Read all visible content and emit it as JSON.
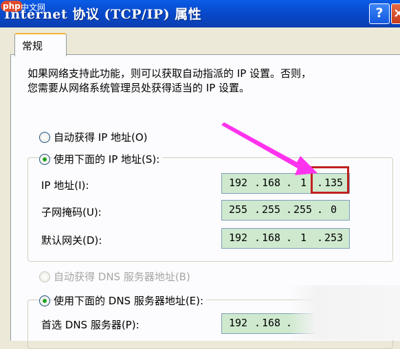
{
  "window": {
    "title": "Internet 协议 (TCP/IP) 属性",
    "help_label": "?",
    "close_label": "×"
  },
  "watermark": {
    "brand": "php",
    "site": "中文网"
  },
  "tabs": [
    {
      "label": "常规"
    }
  ],
  "description": {
    "line1": "如果网络支持此功能，则可以获取自动指派的 IP 设置。否则，",
    "line2": "您需要从网络系统管理员处获得适当的 IP 设置。"
  },
  "ip_section": {
    "auto_label": "自动获得 IP 地址(O)",
    "manual_label": "使用下面的 IP 地址(S):",
    "selected": "manual",
    "fields": [
      {
        "label": "IP 地址(I):",
        "octets": [
          "192",
          "168",
          "1",
          "135"
        ]
      },
      {
        "label": "子网掩码(U):",
        "octets": [
          "255",
          "255",
          "255",
          "0"
        ]
      },
      {
        "label": "默认网关(D):",
        "octets": [
          "192",
          "168",
          "1",
          "253"
        ]
      }
    ]
  },
  "dns_section": {
    "auto_label": "自动获得 DNS 服务器地址(B)",
    "manual_label": "使用下面的 DNS 服务器地址(E):",
    "selected": "manual",
    "fields": [
      {
        "label": "首选 DNS 服务器(P):",
        "octets": [
          "192",
          "168",
          "",
          ""
        ]
      }
    ]
  },
  "annotation": {
    "arrow_color": "#ff33ee",
    "highlight_color": "#c0201f"
  }
}
